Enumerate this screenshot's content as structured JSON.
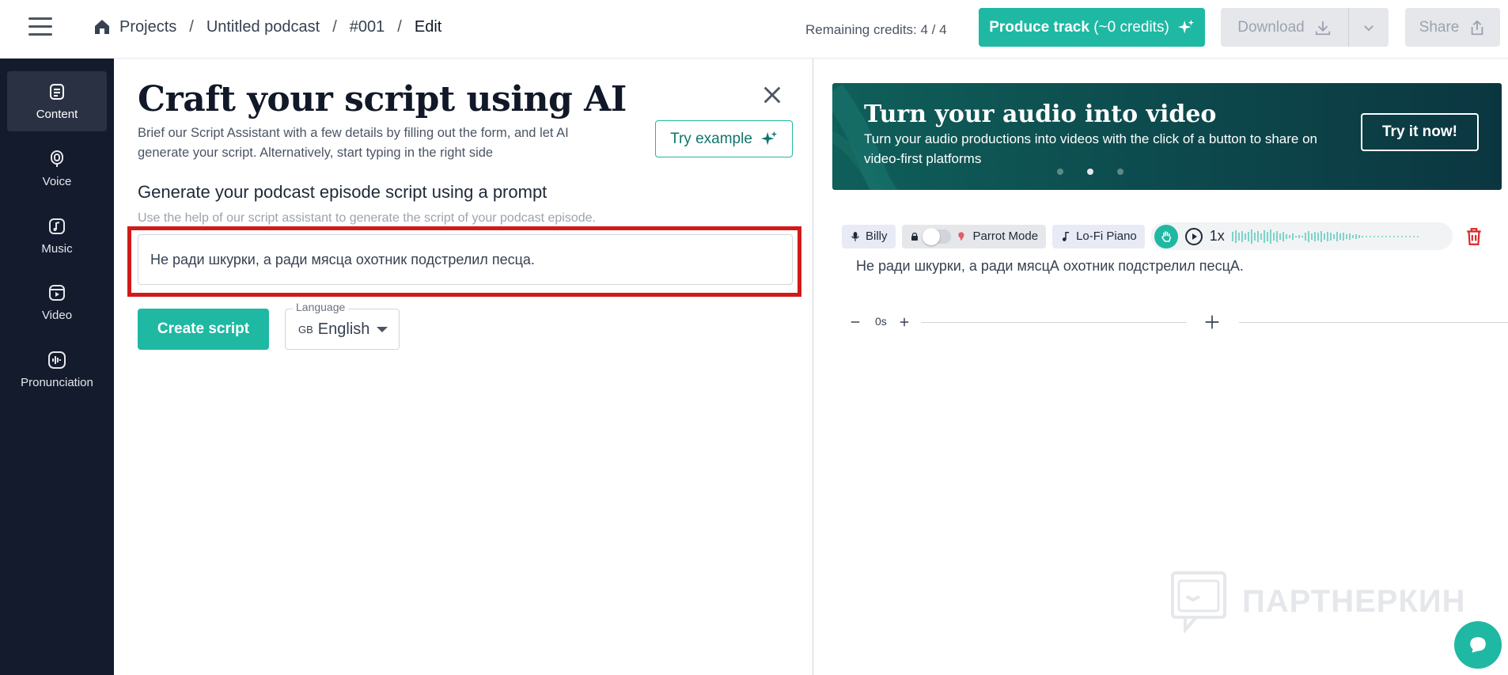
{
  "header": {
    "breadcrumb": [
      "Projects",
      "Untitled podcast",
      "#001",
      "Edit"
    ],
    "separator": "/",
    "credits": "Remaining credits: 4 / 4",
    "produce_label": "Produce track",
    "produce_sub": " (~0 credits)",
    "download_label": "Download",
    "share_label": "Share"
  },
  "sidebar": {
    "items": [
      {
        "label": "Content",
        "icon": "content-icon",
        "active": true
      },
      {
        "label": "Voice",
        "icon": "microphone-icon"
      },
      {
        "label": "Music",
        "icon": "music-note-icon"
      },
      {
        "label": "Video",
        "icon": "video-icon"
      },
      {
        "label": "Pronunciation",
        "icon": "waveform-icon"
      }
    ]
  },
  "left": {
    "title": "Craft your script using AI",
    "description": "Brief our Script Assistant with a few details by filling out the form, and let AI generate your script. Alternatively, start typing in the right side",
    "try_example": "Try example",
    "heading": "Generate your podcast episode script using a prompt",
    "subheading": "Use the help of our script assistant to generate the script of your podcast episode.",
    "prompt_value": "Не ради шкурки, а ради мясца охотник подстрелил песца.",
    "create_label": "Create script",
    "language_label": "Language",
    "language_flag": "GB",
    "language_value": "English"
  },
  "banner": {
    "title": "Turn your audio into video",
    "text": "Turn your audio productions into videos with the click of a button to share on video-first platforms",
    "cta": "Try it now!"
  },
  "track": {
    "voice": "Billy",
    "parrot": "Parrot Mode",
    "music": "Lo-Fi Piano",
    "speed": "1x",
    "text": "Не ради шкурки, а ради мясцА охотник подстрелил песцА."
  },
  "timeline": {
    "pause_label": "0s"
  },
  "watermark": "ПАРТНЕРКИН",
  "colors": {
    "accent": "#1fb8a3",
    "sidebar": "#141b2d",
    "highlight": "#d11a1a"
  }
}
